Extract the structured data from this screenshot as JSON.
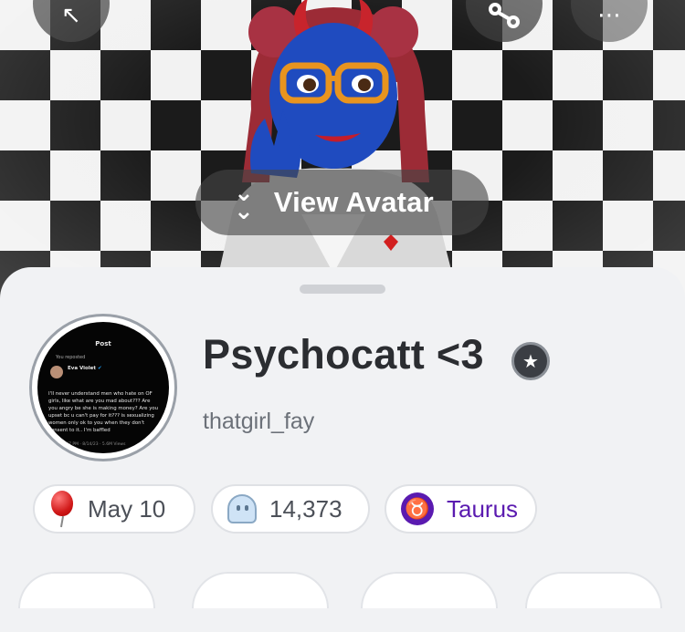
{
  "header": {
    "view_avatar_label": "View Avatar",
    "buttons": {
      "back_icon": "back-arrow-icon",
      "share_icon": "share-icon",
      "more_icon": "more-icon"
    }
  },
  "profile": {
    "display_name": "Psychocatt <3",
    "username": "thatgirl_fay",
    "badge_icon": "star-badge-icon",
    "bitmoji_post": {
      "title": "Post",
      "repost_label": "You reposted",
      "author": "Eva Violet",
      "verified": "✔",
      "text": "I'll never understand men who hate on OF girls, like what are you mad about??? Are you angry be she is making money? Are you upset bc u can't pay for it??? is sexualizing women only ok to you when they don't consent to it.. I'm baffled",
      "footer": "10:47 PM · 8/14/23 · 5.6M Views"
    }
  },
  "chips": {
    "birthday": {
      "icon": "balloon-icon",
      "label": "May 10"
    },
    "snapscore": {
      "icon": "ghost-icon",
      "label": "14,373"
    },
    "zodiac": {
      "icon": "taurus-icon",
      "glyph": "♉",
      "label": "Taurus"
    }
  },
  "colors": {
    "sheet_bg": "#f1f2f4",
    "zodiac_purple": "#5a1ab0",
    "name_text": "#2b2d31"
  }
}
